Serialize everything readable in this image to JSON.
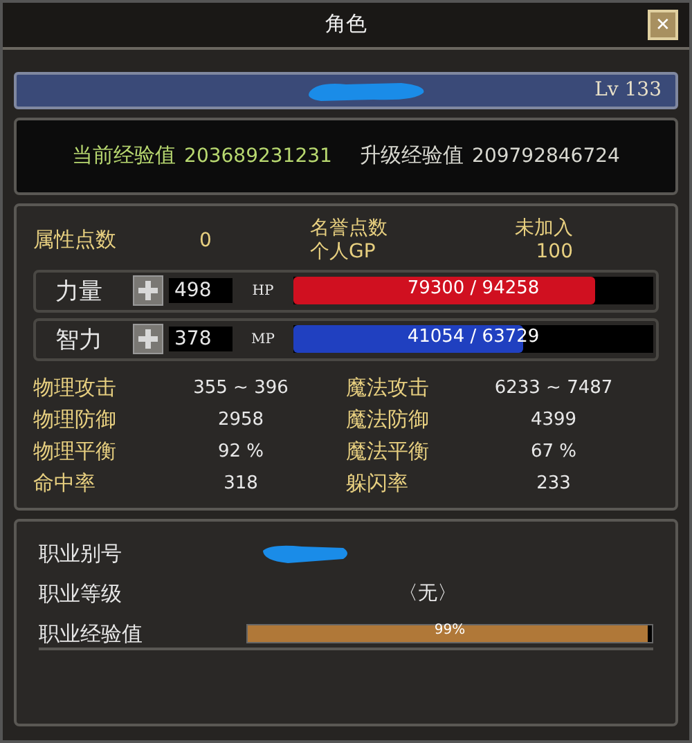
{
  "window": {
    "title": "角色",
    "close": "✕"
  },
  "header": {
    "level": "Lv 133"
  },
  "experience": [
    {
      "label": "当前经验值",
      "value": "203689231231"
    },
    {
      "label": "升级经验值",
      "value": "209792846724"
    }
  ],
  "points": {
    "label": "属性点数",
    "value": "0",
    "honor_label": "名誉点数",
    "honor_value": "未加入",
    "gp_label": "个人GP",
    "gp_value": "100"
  },
  "attributes": [
    {
      "label": "力量",
      "value": "498",
      "bar_label": "HP",
      "reading": "79300 / 94258",
      "level": 0.84,
      "color": "#d01020"
    },
    {
      "label": "智力",
      "value": "378",
      "bar_label": "MP",
      "reading": "41054 / 63729",
      "level": 0.64,
      "color": "#2040c0"
    }
  ],
  "stats": [
    {
      "label": "物理攻击",
      "value": "355 ~ 396"
    },
    {
      "label": "魔法攻击",
      "value": "6233 ~ 7487"
    },
    {
      "label": "物理防御",
      "value": "2958"
    },
    {
      "label": "魔法防御",
      "value": "4399"
    },
    {
      "label": "物理平衡",
      "value": "92 %"
    },
    {
      "label": "魔法平衡",
      "value": "67 %"
    },
    {
      "label": "命中率",
      "value": "318"
    },
    {
      "label": "躲闪率",
      "value": "233"
    }
  ],
  "job": {
    "alias_label": "职业别号",
    "rank_label": "职业等级",
    "rank_value": "〈无〉",
    "exp_label": "职业经验值",
    "exp_reading": "99%",
    "level": 0.99
  }
}
